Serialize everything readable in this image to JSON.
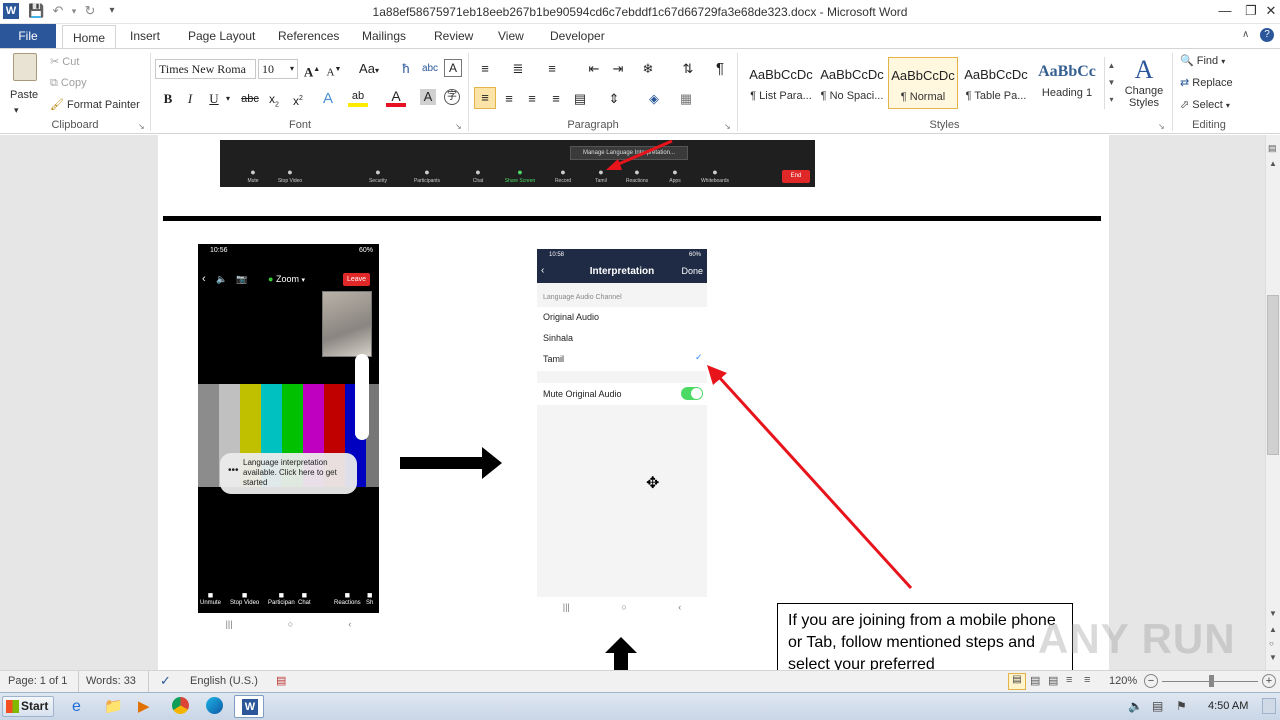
{
  "window": {
    "title": "1a88ef58675971eb18eeb267b1be90594cd6c7ebddf1c67d66729fa3e68de323.docx - Microsoft Word"
  },
  "tabs": [
    "File",
    "Home",
    "Insert",
    "Page Layout",
    "References",
    "Mailings",
    "Review",
    "View",
    "Developer"
  ],
  "clipboard": {
    "paste": "Paste",
    "cut": "Cut",
    "copy": "Copy",
    "format_painter": "Format Painter",
    "label": "Clipboard"
  },
  "font": {
    "family": "Times New Roma",
    "size": "10",
    "label": "Font"
  },
  "paragraph": {
    "label": "Paragraph"
  },
  "styles": {
    "items": [
      {
        "preview": "AaBbCcDc",
        "name": "¶ List Para..."
      },
      {
        "preview": "AaBbCcDc",
        "name": "¶ No Spaci..."
      },
      {
        "preview": "AaBbCcDc",
        "name": "¶ Normal"
      },
      {
        "preview": "AaBbCcDc",
        "name": "¶ Table Pa..."
      },
      {
        "preview": "AaBbCc",
        "name": "Heading 1"
      }
    ],
    "change_styles": "Change Styles",
    "label": "Styles"
  },
  "editing": {
    "find": "Find",
    "replace": "Replace",
    "select": "Select",
    "label": "Editing"
  },
  "document": {
    "zoom_bar": {
      "popup": "Manage Language Interpretation...",
      "items": [
        "Mute",
        "Stop Video",
        "Security",
        "Participants",
        "Chat",
        "Share Screen",
        "Record",
        "Tamil",
        "Reactions",
        "Apps",
        "Whiteboards"
      ],
      "end": "End"
    },
    "phone1": {
      "status": "10:56",
      "battery": "60%",
      "app": "Zoom",
      "leave": "Leave",
      "toast": "Language interpretation available. Click here to get started",
      "bottom": [
        "Unmute",
        "Stop Video",
        "Participan",
        "Chat",
        "Reactions",
        "Sh"
      ]
    },
    "phone2": {
      "status": "10:58",
      "battery": "60%",
      "title": "Interpretation",
      "done": "Done",
      "section": "Language Audio Channel",
      "options": [
        "Original Audio",
        "Sinhala",
        "Tamil"
      ],
      "mute": "Mute Original Audio"
    },
    "callout": "If you are joining from a mobile phone or Tab, follow mentioned steps and select your preferred"
  },
  "status": {
    "page": "Page: 1 of 1",
    "words": "Words: 33",
    "language": "English (U.S.)",
    "zoom": "120%"
  },
  "taskbar": {
    "start": "Start",
    "time": "4:50 AM"
  },
  "watermark": "ANY RUN",
  "colors": {
    "word_blue": "#2b579a",
    "arrow_red": "#e8141b",
    "zoom_end": "#e02828",
    "toggle_green": "#4cd964"
  }
}
